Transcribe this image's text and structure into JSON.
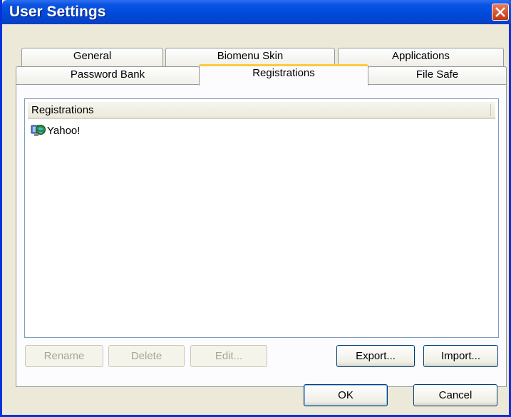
{
  "window": {
    "title": "User Settings"
  },
  "tabs": {
    "row1": [
      {
        "label": "General"
      },
      {
        "label": "Biomenu Skin"
      },
      {
        "label": "Applications"
      }
    ],
    "row2": [
      {
        "label": "Password Bank"
      },
      {
        "label": "Registrations"
      },
      {
        "label": "File Safe"
      }
    ],
    "active": "Registrations"
  },
  "list": {
    "column_header": "Registrations",
    "items": [
      {
        "label": "Yahoo!",
        "icon": "globe-computer-icon"
      }
    ]
  },
  "panel_buttons": {
    "rename": "Rename",
    "delete": "Delete",
    "edit": "Edit...",
    "export": "Export...",
    "import": "Import..."
  },
  "dialog_buttons": {
    "ok": "OK",
    "cancel": "Cancel"
  },
  "colors": {
    "titlebar": "#0a54e3",
    "active_tab_accent": "#ffc83c",
    "dialog_bg": "#ece9d8"
  }
}
